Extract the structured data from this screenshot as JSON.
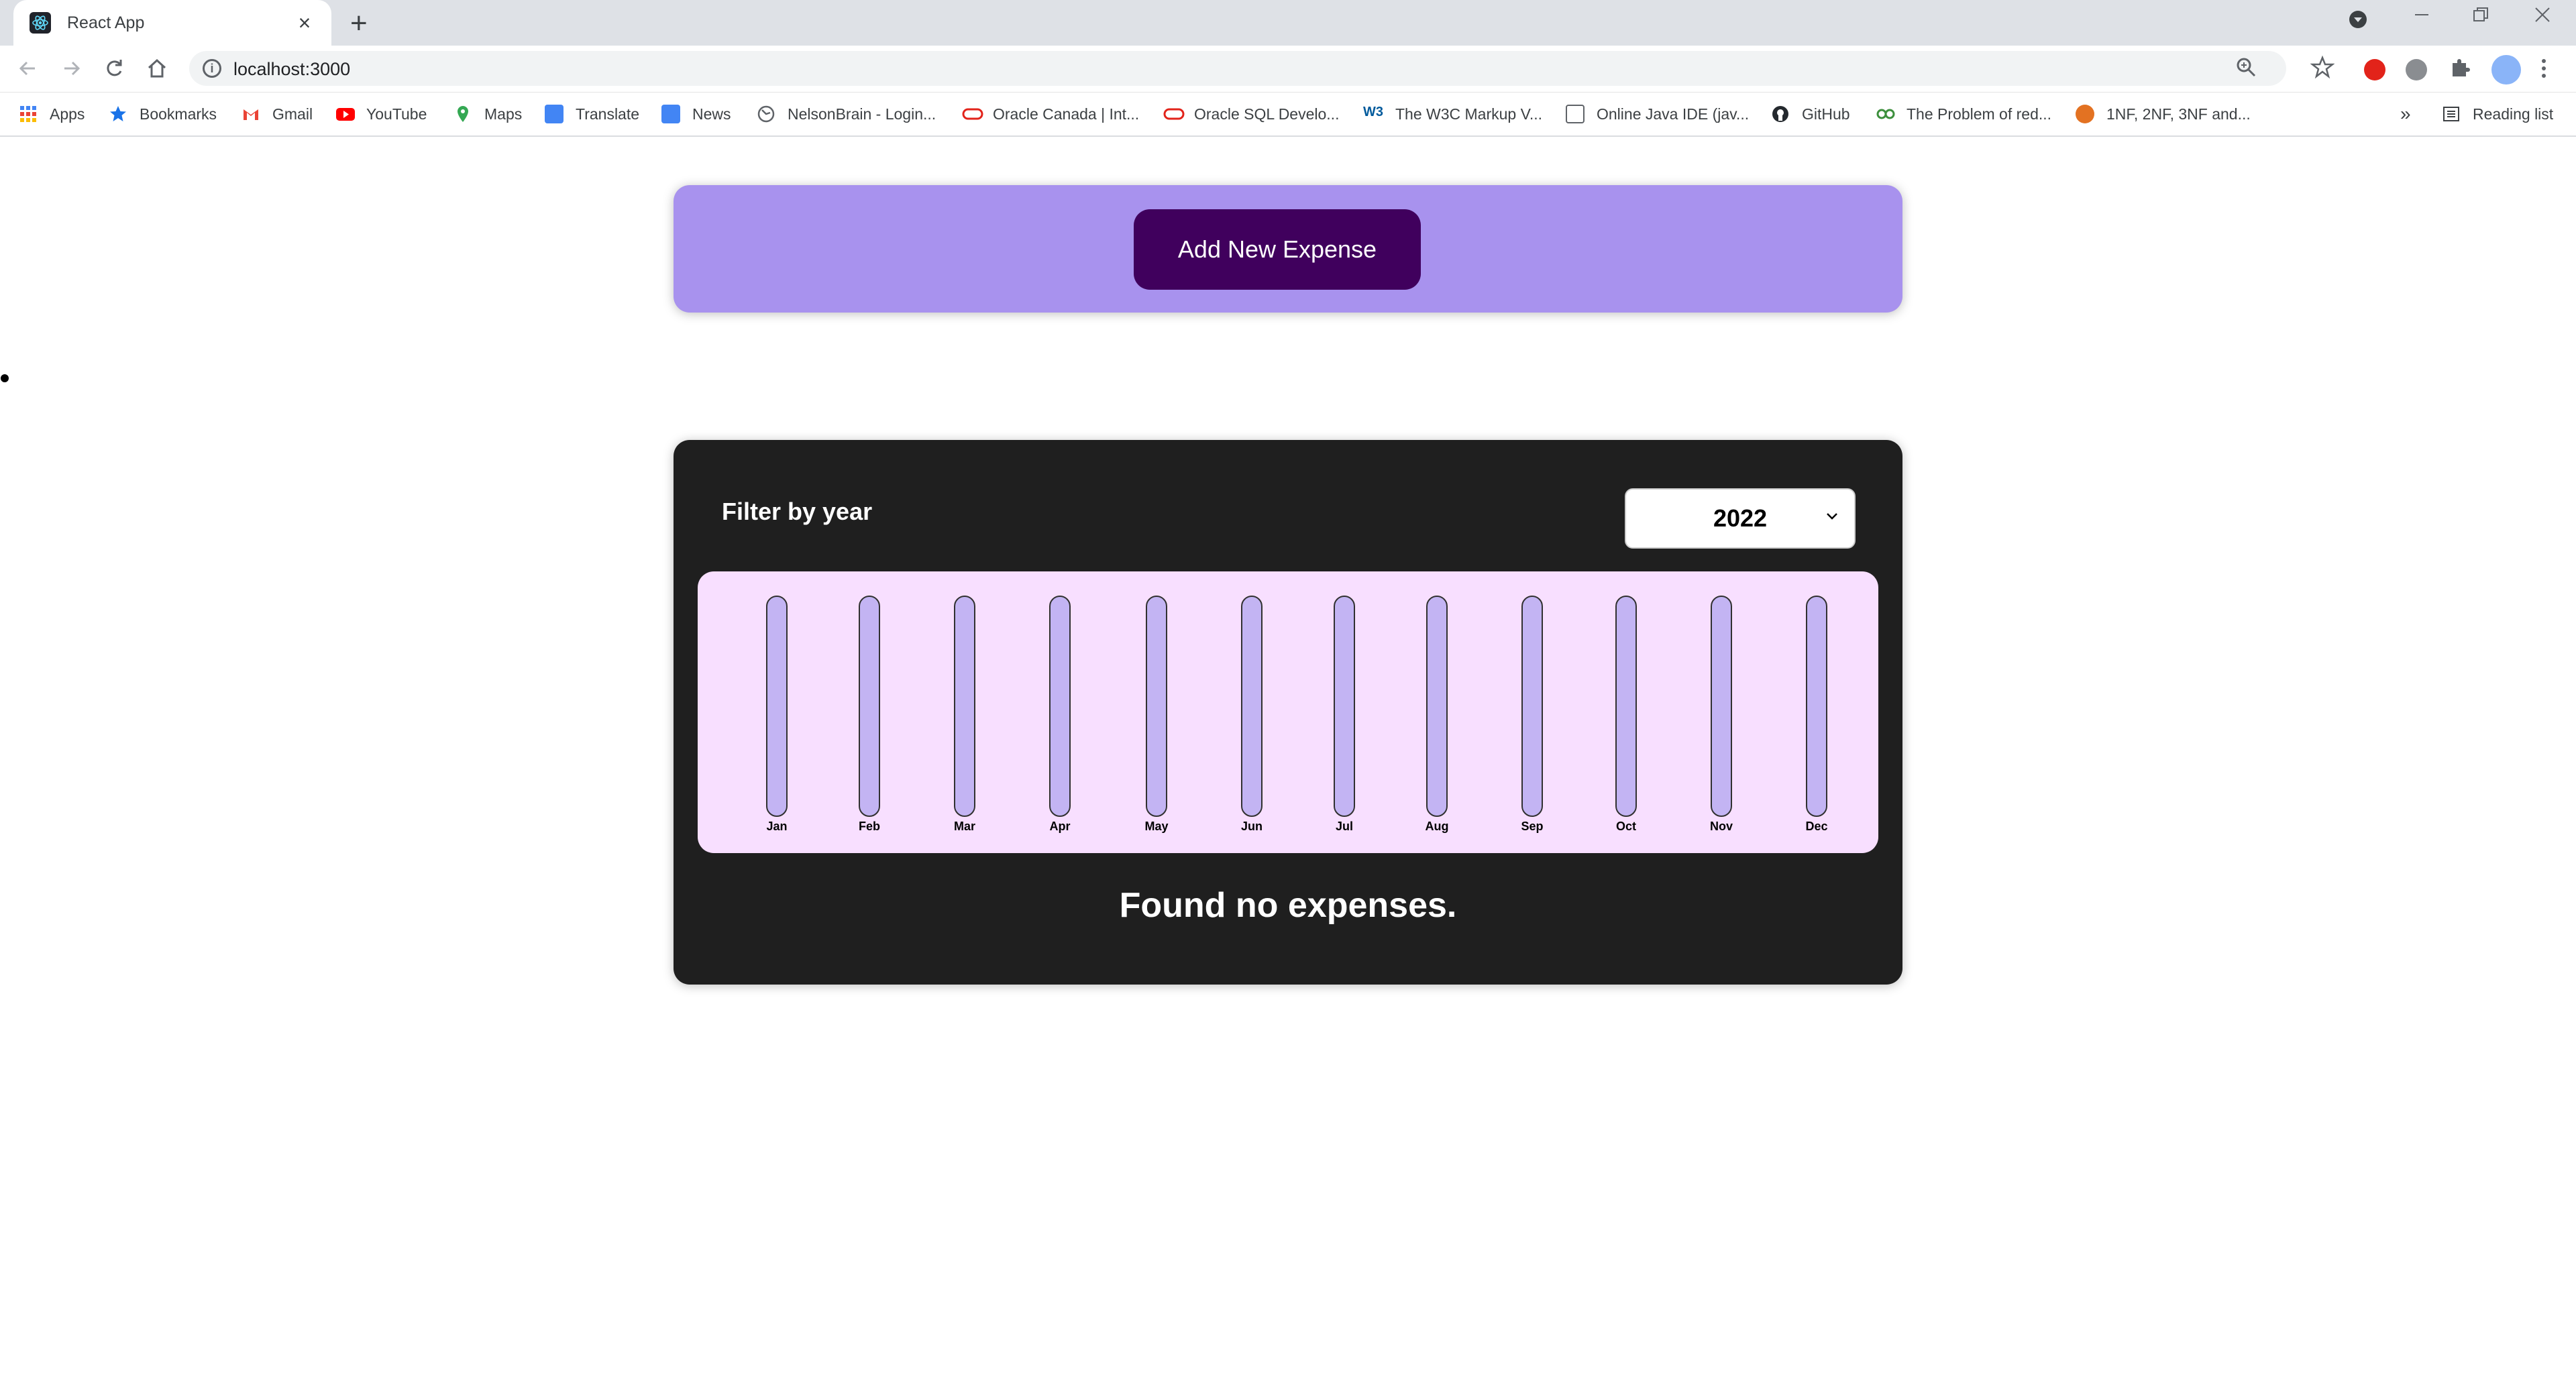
{
  "browser": {
    "tab_title": "React App",
    "new_tab_symbol": "+",
    "url": "localhost:3000",
    "bookmarks": [
      {
        "label": "Apps",
        "icon": "apps-grid-icon",
        "color": "#4285f4"
      },
      {
        "label": "Bookmarks",
        "icon": "star-icon",
        "color": "#1a73e8"
      },
      {
        "label": "Gmail",
        "icon": "gmail-icon",
        "color": "#ea4335"
      },
      {
        "label": "YouTube",
        "icon": "youtube-icon",
        "color": "#ff0000"
      },
      {
        "label": "Maps",
        "icon": "maps-pin-icon",
        "color": "#34a853"
      },
      {
        "label": "Translate",
        "icon": "translate-icon",
        "color": "#4285f4"
      },
      {
        "label": "News",
        "icon": "news-icon",
        "color": "#4285f4"
      },
      {
        "label": "NelsonBrain - Login...",
        "icon": "globe-icon",
        "color": "#5f6368"
      },
      {
        "label": "Oracle Canada | Int...",
        "icon": "oracle-icon",
        "color": "#e2231a"
      },
      {
        "label": "Oracle SQL Develo...",
        "icon": "oracle-icon",
        "color": "#e2231a"
      },
      {
        "label": "The W3C Markup V...",
        "icon": "w3c-icon",
        "color": "#005a9c"
      },
      {
        "label": "Online Java IDE (jav...",
        "icon": "java-icon",
        "color": "#5f6368"
      },
      {
        "label": "GitHub",
        "icon": "github-icon",
        "color": "#24292e"
      },
      {
        "label": "The Problem of red...",
        "icon": "site-icon",
        "color": "#3c8f3c"
      },
      {
        "label": "1NF, 2NF, 3NF and...",
        "icon": "site-icon",
        "color": "#e37222"
      }
    ],
    "overflow_symbol": "»",
    "reading_list": "Reading list"
  },
  "new_expense": {
    "button_label": "Add New Expense"
  },
  "expenses": {
    "filter_label": "Filter by year",
    "selected_year": "2022",
    "empty_message": "Found no expenses."
  },
  "chart_data": {
    "type": "bar",
    "categories": [
      "Jan",
      "Feb",
      "Mar",
      "Apr",
      "May",
      "Jun",
      "Jul",
      "Aug",
      "Sep",
      "Oct",
      "Nov",
      "Dec"
    ],
    "values": [
      0,
      0,
      0,
      0,
      0,
      0,
      0,
      0,
      0,
      0,
      0,
      0
    ],
    "ylim": [
      0,
      1
    ],
    "colors": {
      "track": "#c3b4f3",
      "fill": "#4826b9",
      "background": "#f8dfff"
    }
  }
}
